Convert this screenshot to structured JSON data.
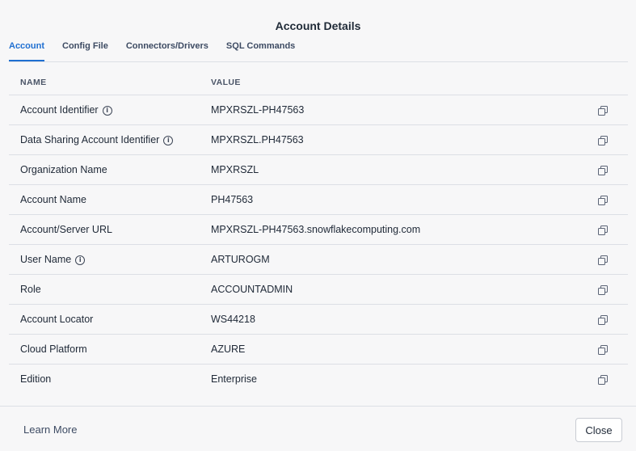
{
  "dialog": {
    "title": "Account Details"
  },
  "tabs": [
    {
      "label": "Account",
      "active": true
    },
    {
      "label": "Config File",
      "active": false
    },
    {
      "label": "Connectors/Drivers",
      "active": false
    },
    {
      "label": "SQL Commands",
      "active": false
    }
  ],
  "table": {
    "headers": {
      "name": "NAME",
      "value": "VALUE"
    },
    "rows": [
      {
        "name": "Account Identifier",
        "value": "MPXRSZL-PH47563",
        "info": true
      },
      {
        "name": "Data Sharing Account Identifier",
        "value": "MPXRSZL.PH47563",
        "info": true
      },
      {
        "name": "Organization Name",
        "value": "MPXRSZL",
        "info": false
      },
      {
        "name": "Account Name",
        "value": "PH47563",
        "info": false
      },
      {
        "name": "Account/Server URL",
        "value": "MPXRSZL-PH47563.snowflakecomputing.com",
        "info": false
      },
      {
        "name": "User Name",
        "value": "ARTUROGM",
        "info": true
      },
      {
        "name": "Role",
        "value": "ACCOUNTADMIN",
        "info": false
      },
      {
        "name": "Account Locator",
        "value": "WS44218",
        "info": false
      },
      {
        "name": "Cloud Platform",
        "value": "AZURE",
        "info": false
      },
      {
        "name": "Edition",
        "value": "Enterprise",
        "info": false
      }
    ]
  },
  "footer": {
    "learn_more": "Learn More",
    "close_label": "Close"
  },
  "icons": {
    "info": "info-icon",
    "copy": "copy-icon"
  },
  "colors": {
    "accent": "#1f6fd1"
  }
}
